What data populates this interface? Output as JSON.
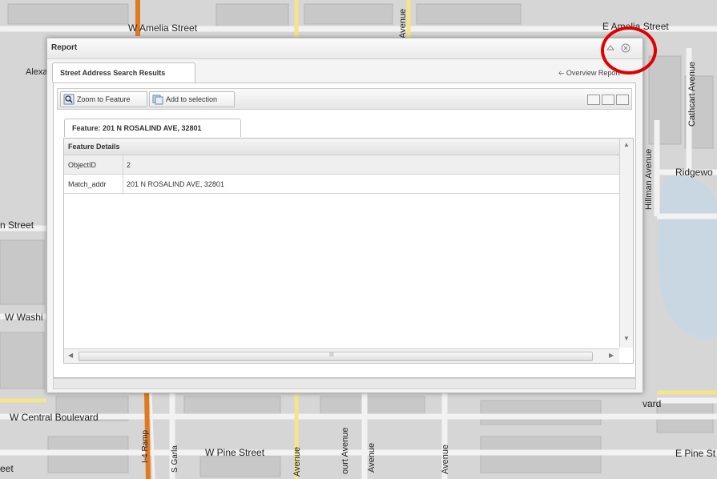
{
  "map": {
    "labels": {
      "w_amelia": "W Amelia Street",
      "e_amelia": "E Amelia Street",
      "alexa": "Alexa",
      "avenue_top": "Avenue",
      "cathcart": "Cathcart Avenue",
      "hillman": "Hillman Avenue",
      "ridgewood": "Ridgewo",
      "n_street": "n Street",
      "w_washi": "W Washi",
      "vard": "vard",
      "w_central": "W Central Boulevard",
      "i4_ramp": "I-4 Ramp",
      "s_garland": "S Garla",
      "w_pine": "W Pine Street",
      "avenue_b1": "Avenue",
      "court_avenue": "ourt Avenue",
      "avenue_b2": "Avenue",
      "avenue_b3": "Avenue",
      "e_pine": "E Pine St",
      "eet": "eet"
    }
  },
  "dialog": {
    "title": "Report",
    "tab_label": "Street Address Search Results",
    "overview_report": "Overview Report",
    "toolbar": {
      "zoom_label": "Zoom to Feature",
      "add_label": "Add to selection"
    },
    "feature_tab": "Feature: 201 N ROSALIND AVE, 32801",
    "grid": {
      "header": "Feature Details",
      "rows": [
        {
          "key": "ObjectID",
          "value": "2"
        },
        {
          "key": "Match_addr",
          "value": "201 N ROSALIND AVE, 32801"
        }
      ],
      "scroll_mid": "III"
    }
  },
  "icons": [
    "minimize-icon",
    "close-icon",
    "arrow-left-icon",
    "zoom-icon",
    "add-selection-icon",
    "layout-icon"
  ],
  "colors": {
    "highlight": "#e00000",
    "road_orange": "#e07a1f",
    "road_yellow": "#f4e48a"
  }
}
